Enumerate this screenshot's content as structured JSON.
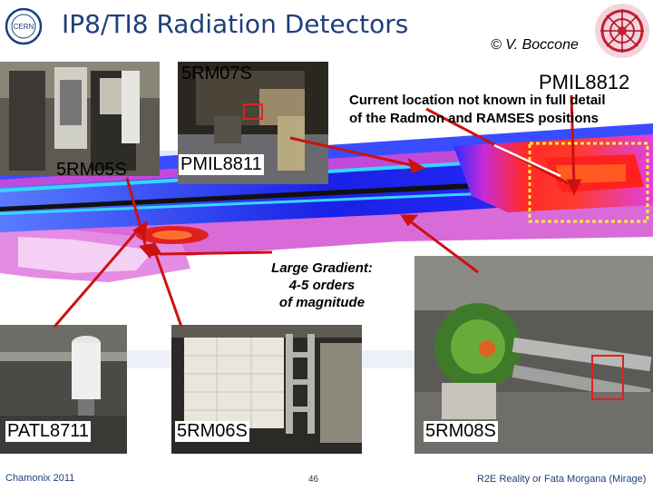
{
  "header": {
    "title": "IP8/TI8 Radiation Detectors",
    "author": "© V. Boccone",
    "cern_logo_text": "CERN"
  },
  "photos": {
    "rm07s": "5RM07S",
    "rm05s": "5RM05S",
    "pmil8811": "PMIL8811",
    "pmil8812": "PMIL8812",
    "patl8711": "PATL8711",
    "rm06s": "5RM06S",
    "rm08s": "5RM08S"
  },
  "annotations": {
    "note": "Current location not known in full detail of the Radmon and RAMSES positions",
    "gradient_line1": "Large Gradient:",
    "gradient_line2": "4-5 orders",
    "gradient_line3": "of magnitude"
  },
  "footer": {
    "left": "Chamonix 2011",
    "page": "46",
    "right": "R2E Reality or Fata Morgana (Mirage)"
  },
  "colors": {
    "title": "#1f3f7a",
    "arrow": "#cc1111",
    "highlight_box": "#ffeb3b",
    "map_blue": "#0a1fd8",
    "map_magenta": "#e040e0",
    "map_red": "#e01a1a"
  }
}
